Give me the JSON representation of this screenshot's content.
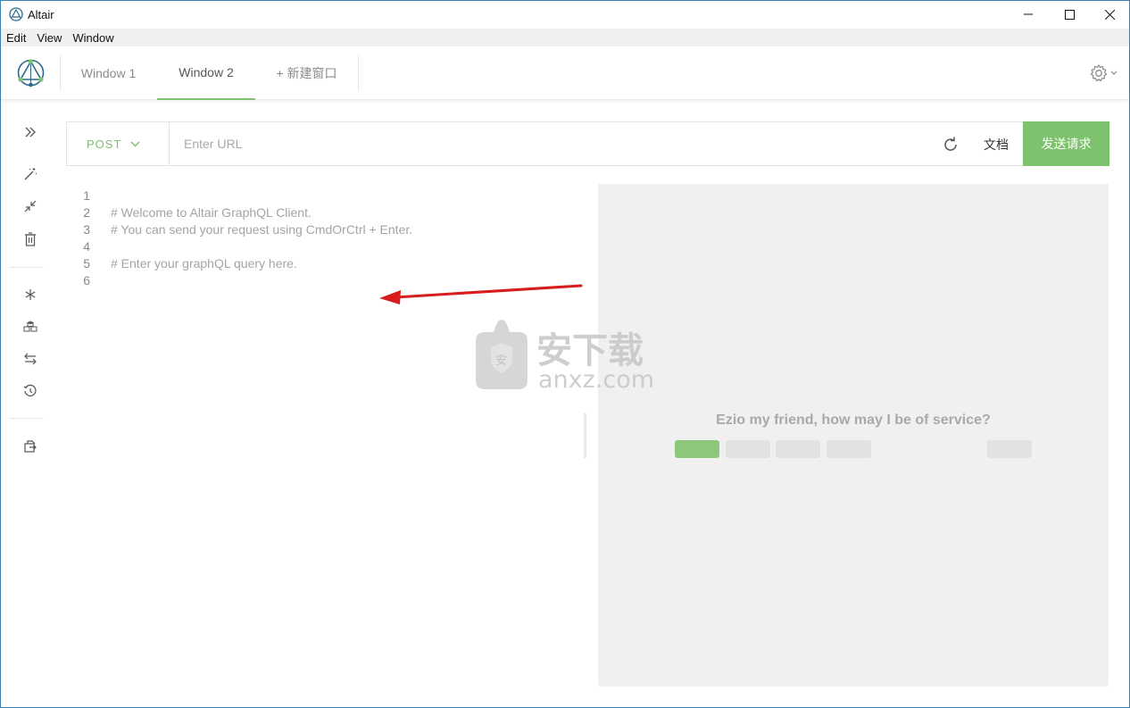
{
  "window": {
    "title": "Altair",
    "controls": {
      "minimize": "minimize-icon",
      "maximize": "maximize-icon",
      "close": "close-icon"
    }
  },
  "menu": {
    "items": [
      "Edit",
      "View",
      "Window"
    ]
  },
  "tabs": [
    {
      "label": "Window 1",
      "active": false
    },
    {
      "label": "Window 2",
      "active": true
    },
    {
      "label": "+ 新建窗口",
      "active": false
    }
  ],
  "settings_icon": "gear-icon",
  "sidebar": {
    "icons": [
      "expand-icon",
      "prettify-icon",
      "compress-icon",
      "clear-icon",
      "variables-icon",
      "headers-icon",
      "subscription-icon",
      "history-icon",
      "export-icon"
    ]
  },
  "request": {
    "method": "POST",
    "url_placeholder": "Enter URL",
    "url_value": "",
    "docs_label": "文档",
    "send_label": "发送请求"
  },
  "editor": {
    "lines": [
      {
        "num": "1",
        "text": ""
      },
      {
        "num": "2",
        "text": "# Welcome to Altair GraphQL Client."
      },
      {
        "num": "3",
        "text": "# You can send your request using CmdOrCtrl + Enter."
      },
      {
        "num": "4",
        "text": ""
      },
      {
        "num": "5",
        "text": "# Enter your graphQL query here."
      },
      {
        "num": "6",
        "text": ""
      }
    ]
  },
  "result": {
    "greeting": "Ezio my friend, how may I be of service?"
  },
  "colors": {
    "accent": "#7ec16e",
    "annotation_arrow": "#d71d1d"
  },
  "watermark": {
    "text_cn": "安下载",
    "text_en": "anxz.com"
  }
}
